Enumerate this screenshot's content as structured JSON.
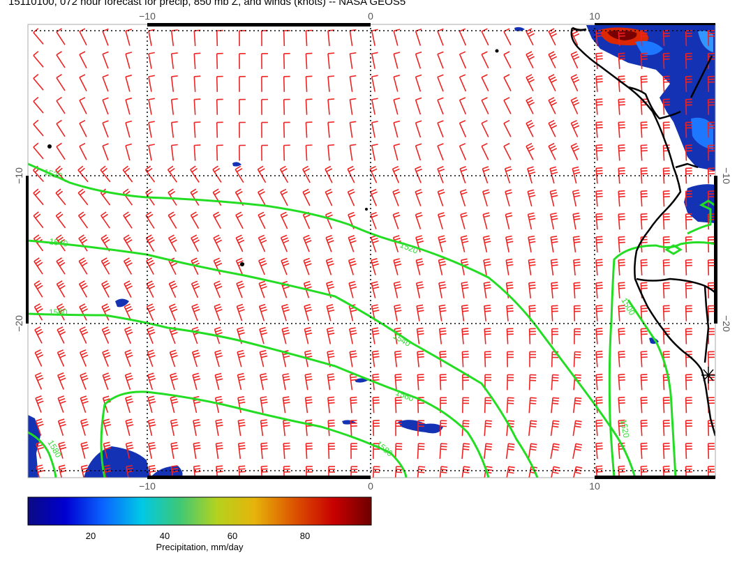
{
  "title": "15110100, 072 hour forecast for precip, 850 mb Z, and winds (knots) -- NASA GEOS5",
  "axes": {
    "top_lon_ticks": [
      "−10",
      "0",
      "10"
    ],
    "bottom_lon_ticks": [
      "−10",
      "0",
      "10"
    ],
    "left_lat_ticks": [
      "−10",
      "−20"
    ],
    "right_lat_ticks": [
      "−10",
      "−20"
    ]
  },
  "contours": {
    "labels": [
      "1520",
      "1540",
      "1560",
      "1520",
      "1540",
      "1560",
      "1580",
      "1500",
      "1520",
      "1580"
    ]
  },
  "colorbar": {
    "ticks": [
      "20",
      "40",
      "60",
      "80"
    ],
    "label": "Precipitation, mm/day",
    "gradient": [
      "#0a0a82",
      "#0000d2",
      "#0a64ff",
      "#00c8e6",
      "#3cc878",
      "#b4d21e",
      "#e6b40a",
      "#dc5000",
      "#c80000",
      "#6e0000"
    ]
  },
  "colors": {
    "barbs": "#ee2222",
    "contours": "#22dd22",
    "coast": "#000000"
  }
}
